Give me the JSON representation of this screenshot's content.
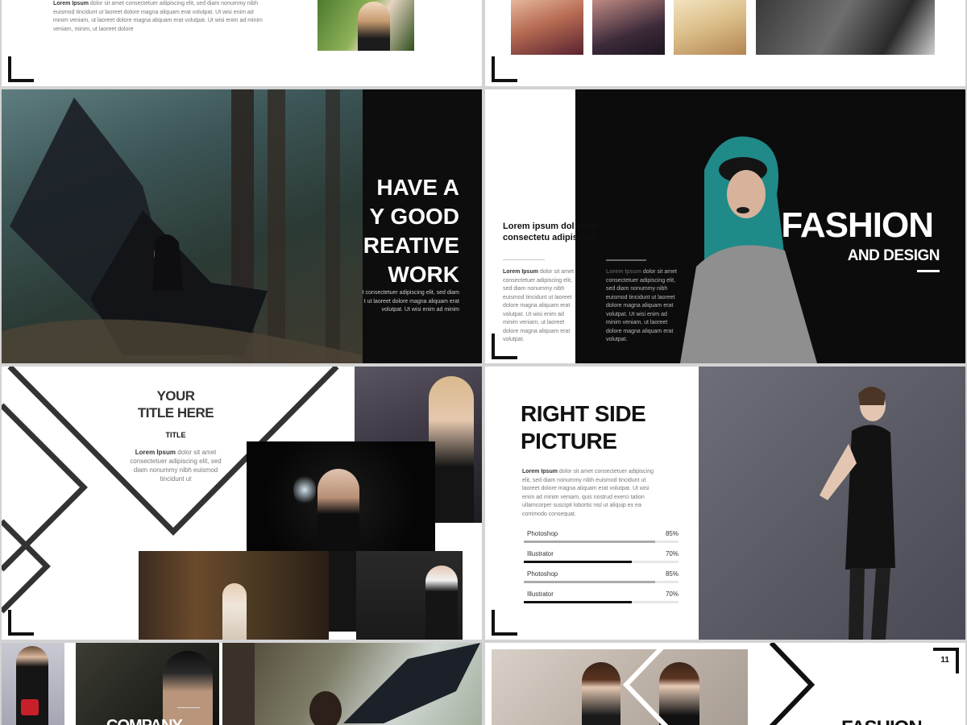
{
  "slides": {
    "s1": {
      "heading": "Lorem Ipsum",
      "body": "dolor sit amet consectetuer adipiscing elit, sed diam nonummy nibh euismod tincidunt ut laoreet dolore magna aliquam erat volutpat. Ut wisi enim ad minim veniam, ut laoreet dolore magna aliquam erat volutpat. Ut wisi enim ad minim veniam, minim, ut laoreet dolore"
    },
    "s3": {
      "title_lines": [
        "HAVE A",
        "Y GOOD",
        "REATIVE",
        "WORK"
      ],
      "body": "t consectetuer adipiscing elit, sed diam t ut laoreet dolore magna aliquam erat volutpat. Ut wisi enim ad minim"
    },
    "s4": {
      "subhead": "Lorem ipsum dol amet consectetu adipiscing",
      "col1_heading": "Lorem Ipsum",
      "col1_body": "dolor sit amet consectetuer adipiscing elit, sed diam nonummy nibh euismod tincidunt ut laoreet dolore magna aliquam erat volutpat. Ut wisi enim ad minim veniam, ut laoreet dolore magna aliquam erat volutpat.",
      "col2_heading": "Lorem Ipsum",
      "col2_body": "dolor sit amet consectetuer adipiscing elit, sed diam nonummy nibh euismod tincidunt ut laoreet dolore magna aliquam erat volutpat. Ut wisi enim ad minim veniam, ut laoreet dolore magna aliquam erat volutpat.",
      "title": "FASHION",
      "subtitle": "AND DESIGN"
    },
    "s5": {
      "title_line1": "YOUR",
      "title_line2": "TITLE HERE",
      "label": "TITLE",
      "body_heading": "Lorem Ipsum",
      "body": "dolor sit amet consectetuer adipiscing elit, sed diam nonummy nibh euismod tincidunt ut"
    },
    "s6": {
      "title_line1": "RIGHT SIDE",
      "title_line2": "PICTURE",
      "body_heading": "Lorem Ipsum",
      "body": "dolor sit amet consectetuer adipiscing elit, sed diam nonummy nibh euismod tincidunt ut laoreet dolore magna aliquam erat volutpat. Ut wisi enim ad minim veniam, quis nostrud exerci tation ullamcorper suscipit lobortis nisl ut aliquip ex ea commodo consequat.",
      "skills": [
        {
          "label": "Photoshop",
          "pct": "85%",
          "value": 0.85,
          "color": "#aaaaaa"
        },
        {
          "label": "Illustrator",
          "pct": "70%",
          "value": 0.7,
          "color": "#111111"
        },
        {
          "label": "Photoshop",
          "pct": "85%",
          "value": 0.85,
          "color": "#aaaaaa"
        },
        {
          "label": "Illustrator",
          "pct": "70%",
          "value": 0.7,
          "color": "#111111"
        }
      ]
    },
    "s7": {
      "title": "COMPANY"
    },
    "s8": {
      "page_number": "11",
      "title": "FASHION"
    }
  }
}
